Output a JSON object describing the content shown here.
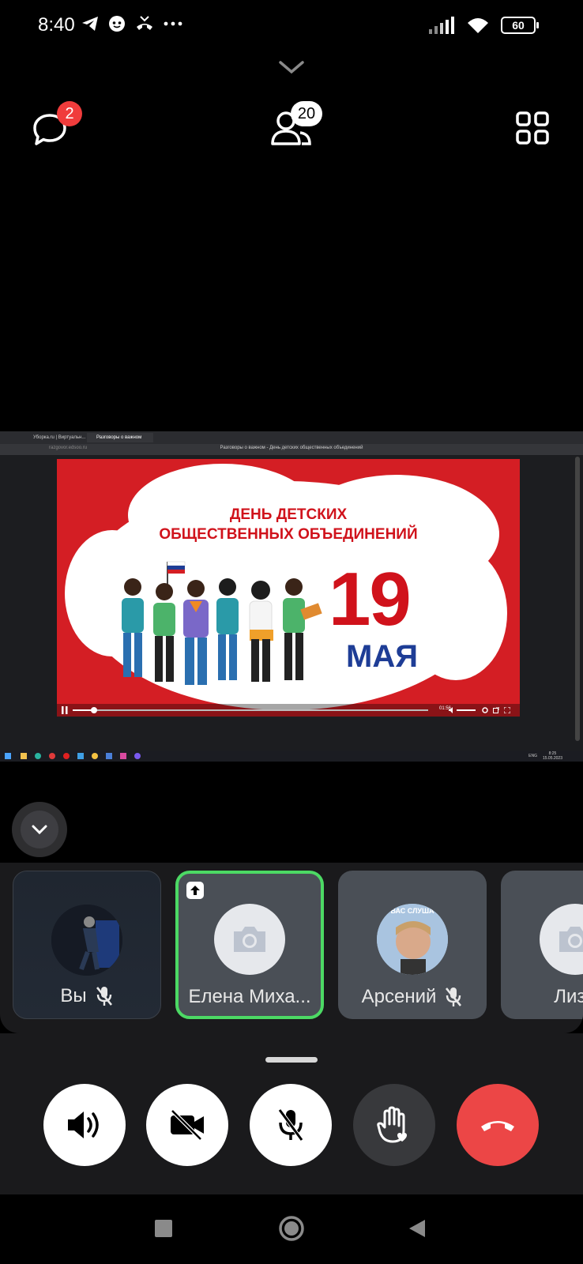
{
  "status_bar": {
    "time": "8:40",
    "battery": "60"
  },
  "call_header": {
    "chat_badge": "2",
    "participants_count": "20"
  },
  "shared_screen": {
    "tab1_label": "Уборка.ru | Виртуальн...",
    "tab2_label": "Разговоры о важном",
    "url": "razgovor.edsoo.ru",
    "page_title": "Разговоры о важном - День детских общественных объединений",
    "video_title_line1": "ДЕНЬ ДЕТСКИХ",
    "video_title_line2": "ОБЩЕСТВЕННЫХ ОБЪЕДИНЕНИЙ",
    "date_number": "19",
    "date_month": "МАЯ",
    "video_time": "01:56",
    "video_progress": 0.06,
    "taskbar_lang": "ENG",
    "taskbar_clock": "8:25",
    "taskbar_date": "15.05.2023"
  },
  "participants": [
    {
      "name": "Вы",
      "muted": true,
      "avatar": "photo"
    },
    {
      "name": "Елена Миха...",
      "muted": false,
      "avatar": "camera-icon",
      "speaking": true
    },
    {
      "name": "Арсений",
      "muted": true,
      "avatar": "photo"
    },
    {
      "name": "Лиза",
      "muted": false,
      "avatar": "camera-icon"
    }
  ],
  "avatar_caption_arseniy": "ВАС СЛУША",
  "controls": {
    "speaker": "speaker-icon",
    "camera": "camera-off-icon",
    "mic": "mic-off-icon",
    "raise_hand": "raise-hand-icon",
    "end_call": "end-call-icon"
  },
  "colors": {
    "end_call": "#ec4646",
    "active_speaker_border": "#4cd964",
    "badge": "#f03c3c",
    "banner_red": "#d41e24",
    "banner_blue": "#1e3d96"
  }
}
